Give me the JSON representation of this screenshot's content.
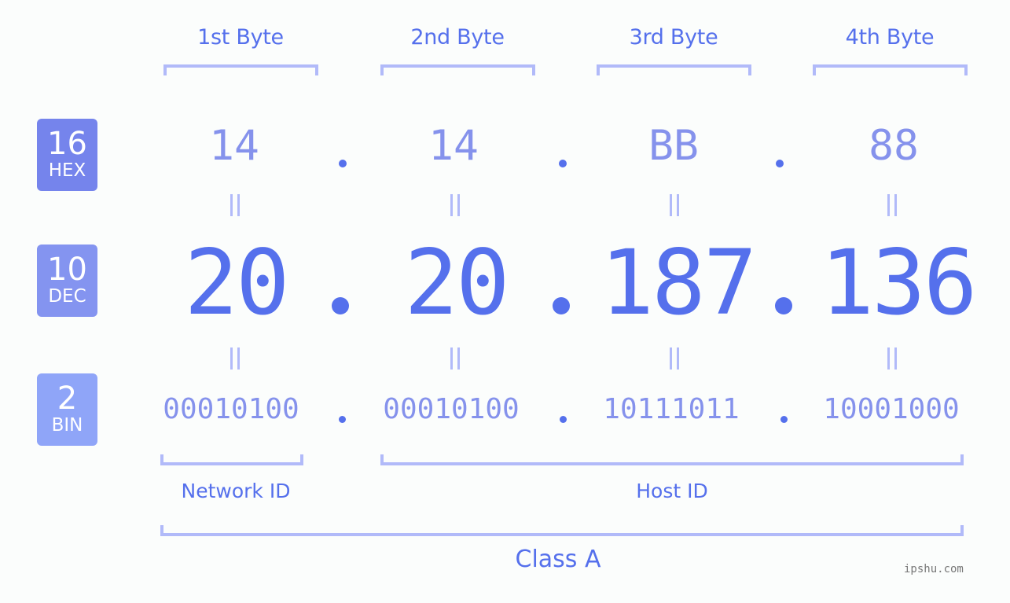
{
  "headers": [
    "1st Byte",
    "2nd Byte",
    "3rd Byte",
    "4th Byte"
  ],
  "badges": {
    "hex": {
      "number": "16",
      "label": "HEX"
    },
    "dec": {
      "number": "10",
      "label": "DEC"
    },
    "bin": {
      "number": "2",
      "label": "BIN"
    }
  },
  "ip": {
    "hex": [
      "14",
      "14",
      "BB",
      "88"
    ],
    "dec": [
      "20",
      "20",
      "187",
      "136"
    ],
    "bin": [
      "00010100",
      "00010100",
      "10111011",
      "10001000"
    ]
  },
  "groups": {
    "network_id": "Network ID",
    "host_id": "Host ID",
    "class": "Class A"
  },
  "watermark": "ipshu.com",
  "colors": {
    "primary": "#5570ec",
    "secondary": "#8592ec",
    "bracket": "#b1baf9",
    "badge_hex": "#7584ec",
    "badge_dec": "#8494f0",
    "badge_bin": "#8fa5f8"
  }
}
